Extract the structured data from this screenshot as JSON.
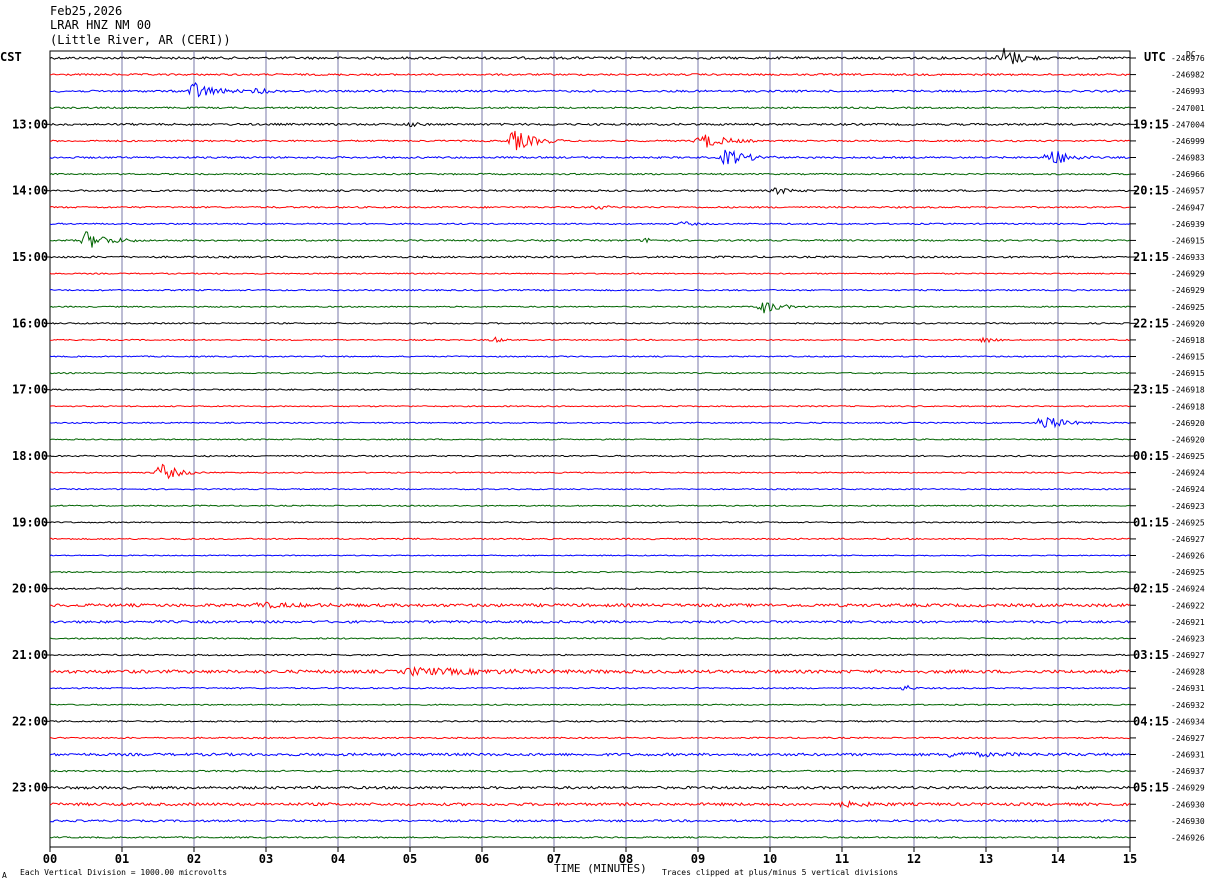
{
  "header": {
    "date": "Feb25,2026",
    "station": "LRAR HNZ NM 00",
    "location": "(Little River, AR (CERI))"
  },
  "corner_labels": {
    "left": "CST",
    "right": "UTC",
    "dc": "DC"
  },
  "footer": {
    "scale_note": "Each Vertical Division = 1000.00 microvolts",
    "xlabel": "TIME (MINUTES)",
    "clip_note": "Traces clipped at plus/minus 5 vertical divisions",
    "mark": "A"
  },
  "colors": {
    "trace_cycle": [
      "#000000",
      "#ff0000",
      "#0000ff",
      "#006400"
    ],
    "grid": "#a0a0a0",
    "grid_v": "#7a7aa8"
  },
  "chart_data": {
    "type": "line",
    "title": "LRAR HNZ NM 00",
    "xlabel": "TIME (MINUTES)",
    "xlim": [
      0,
      15
    ],
    "x_ticks": [
      "00",
      "01",
      "02",
      "03",
      "04",
      "05",
      "06",
      "07",
      "08",
      "09",
      "10",
      "11",
      "12",
      "13",
      "14",
      "15"
    ],
    "rows_per_hour": 4,
    "left_hour_labels": [
      "13:00",
      "14:00",
      "15:00",
      "16:00",
      "17:00",
      "18:00",
      "19:00",
      "20:00",
      "21:00",
      "22:00",
      "23:00"
    ],
    "right_hour_labels": [
      "19:15",
      "20:15",
      "21:15",
      "22:15",
      "23:15",
      "00:15",
      "01:15",
      "02:15",
      "03:15",
      "04:15",
      "05:15"
    ],
    "dc_offsets": [
      "-246976",
      "-246982",
      "-246993",
      "-247001",
      "-247004",
      "-246999",
      "-246983",
      "-246966",
      "-246957",
      "-246947",
      "-246939",
      "-246915",
      "-246933",
      "-246929",
      "-246929",
      "-246925",
      "-246920",
      "-246918",
      "-246915",
      "-246915",
      "-246918",
      "-246918",
      "-246920",
      "-246920",
      "-246925",
      "-246924",
      "-246924",
      "-246923",
      "-246925",
      "-246927",
      "-246926",
      "-246925",
      "-246924",
      "-246922",
      "-246921",
      "-246923",
      "-246927",
      "-246928",
      "-246931",
      "-246932",
      "-246934",
      "-246927",
      "-246931",
      "-246937",
      "-246929",
      "-246930",
      "-246930",
      "-246926"
    ],
    "noise_levels": [
      1.2,
      0.9,
      1.0,
      0.8,
      1.0,
      0.8,
      0.9,
      0.7,
      0.9,
      0.8,
      0.7,
      0.8,
      0.9,
      0.6,
      0.7,
      0.6,
      0.7,
      0.6,
      0.6,
      0.6,
      0.7,
      0.6,
      0.6,
      0.6,
      0.7,
      0.6,
      0.6,
      0.6,
      0.6,
      0.7,
      0.5,
      0.6,
      0.7,
      1.5,
      1.2,
      0.7,
      0.7,
      1.6,
      0.7,
      0.6,
      0.7,
      0.7,
      1.3,
      0.8,
      1.3,
      1.4,
      1.0,
      0.7
    ],
    "events": [
      {
        "row": 0,
        "minute": 13.25,
        "amp": 11,
        "dur": 0.6
      },
      {
        "row": 2,
        "minute": 2.0,
        "amp": 9,
        "dur": 0.7
      },
      {
        "row": 2,
        "minute": 2.9,
        "amp": 3,
        "dur": 0.3
      },
      {
        "row": 4,
        "minute": 5.0,
        "amp": 2,
        "dur": 0.3
      },
      {
        "row": 5,
        "minute": 6.45,
        "amp": 11,
        "dur": 0.7
      },
      {
        "row": 5,
        "minute": 9.05,
        "amp": 8,
        "dur": 0.8
      },
      {
        "row": 6,
        "minute": 9.4,
        "amp": 9,
        "dur": 0.7
      },
      {
        "row": 6,
        "minute": 13.9,
        "amp": 10,
        "dur": 0.6
      },
      {
        "row": 8,
        "minute": 10.1,
        "amp": 3,
        "dur": 0.5
      },
      {
        "row": 9,
        "minute": 7.6,
        "amp": 2,
        "dur": 0.4
      },
      {
        "row": 10,
        "minute": 8.8,
        "amp": 2,
        "dur": 0.4
      },
      {
        "row": 11,
        "minute": 0.5,
        "amp": 9,
        "dur": 0.8
      },
      {
        "row": 11,
        "minute": 8.3,
        "amp": 2,
        "dur": 0.3
      },
      {
        "row": 15,
        "minute": 9.9,
        "amp": 7,
        "dur": 0.6
      },
      {
        "row": 17,
        "minute": 6.2,
        "amp": 3,
        "dur": 0.2
      },
      {
        "row": 17,
        "minute": 13.0,
        "amp": 3,
        "dur": 0.3
      },
      {
        "row": 22,
        "minute": 13.8,
        "amp": 8,
        "dur": 0.7
      },
      {
        "row": 25,
        "minute": 1.55,
        "amp": 9,
        "dur": 0.6
      },
      {
        "row": 33,
        "minute": 2.9,
        "amp": 2,
        "dur": 1.5
      },
      {
        "row": 37,
        "minute": 5.0,
        "amp": 3,
        "dur": 3.0
      },
      {
        "row": 38,
        "minute": 11.9,
        "amp": 3,
        "dur": 0.2
      },
      {
        "row": 42,
        "minute": 12.5,
        "amp": 2,
        "dur": 2.0
      },
      {
        "row": 45,
        "minute": 11.0,
        "amp": 2,
        "dur": 1.0
      }
    ],
    "grid": true
  }
}
